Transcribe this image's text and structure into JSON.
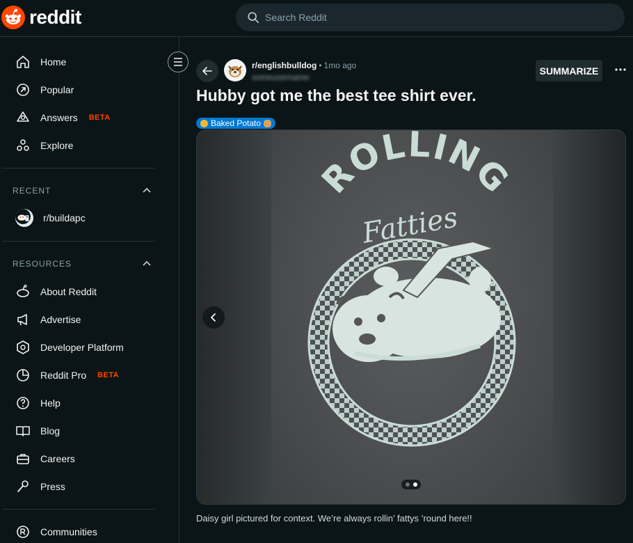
{
  "header": {
    "logo_text": "reddit",
    "search_placeholder": "Search Reddit",
    "brand_color": "#ff4500"
  },
  "sidebar": {
    "main_items": [
      {
        "label": "Home",
        "icon": "home-icon"
      },
      {
        "label": "Popular",
        "icon": "popular-icon"
      },
      {
        "label": "Answers",
        "icon": "answers-icon",
        "badge": "BETA"
      },
      {
        "label": "Explore",
        "icon": "explore-icon"
      }
    ],
    "recent": {
      "heading": "RECENT",
      "items": [
        {
          "label": "r/buildapc",
          "icon": "buildapc-avatar"
        }
      ]
    },
    "resources": {
      "heading": "RESOURCES",
      "items": [
        {
          "label": "About Reddit",
          "icon": "about-icon"
        },
        {
          "label": "Advertise",
          "icon": "megaphone-icon"
        },
        {
          "label": "Developer Platform",
          "icon": "developer-icon"
        },
        {
          "label": "Reddit Pro",
          "icon": "reddit-pro-icon",
          "badge": "BETA"
        },
        {
          "label": "Help",
          "icon": "help-icon"
        },
        {
          "label": "Blog",
          "icon": "blog-icon"
        },
        {
          "label": "Careers",
          "icon": "briefcase-icon"
        },
        {
          "label": "Press",
          "icon": "microphone-icon"
        }
      ]
    },
    "bottom_items": [
      {
        "label": "Communities",
        "icon": "communities-icon"
      }
    ]
  },
  "post": {
    "subreddit": "r/englishbulldog",
    "separator": "•",
    "time": "1mo ago",
    "author": "someusername",
    "summarize_label": "SUMMARIZE",
    "title": "Hubby got me the best tee shirt ever.",
    "flair": "Baked Potato",
    "flair_color": "#0079d3",
    "image_count": 2,
    "active_image_index": 1,
    "caption": "Daisy girl pictured for context. We’re always rollin’ fattys ’round here!!"
  },
  "shirt_print": {
    "top_text": "ROLLING",
    "script_text": "Fatties"
  }
}
